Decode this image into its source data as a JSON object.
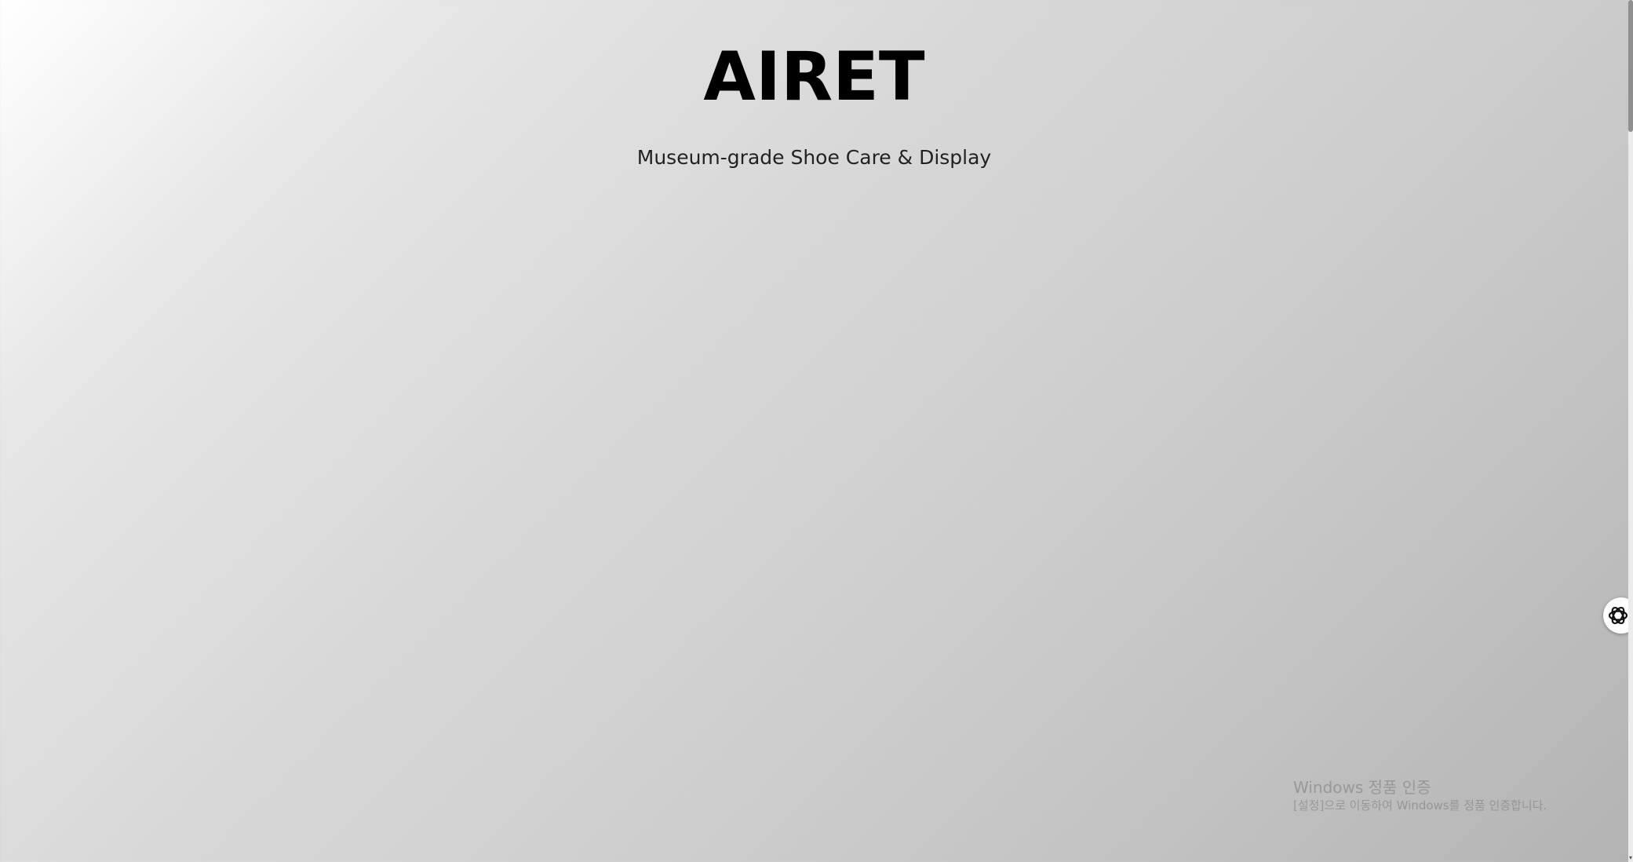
{
  "hero": {
    "title": "AIRET",
    "tagline": "Museum-grade Shoe Care & Display"
  },
  "assistant_widget": {
    "icon": "openai-knot-icon"
  },
  "watermark": {
    "title": "Windows 정품 인증",
    "subtitle": "[설정]으로 이동하여 Windows를 정품 인증합니다."
  },
  "colors": {
    "background_start": "#ffffff",
    "background_end": "#b3b3b3",
    "title": "#000000",
    "tagline": "#222222"
  }
}
